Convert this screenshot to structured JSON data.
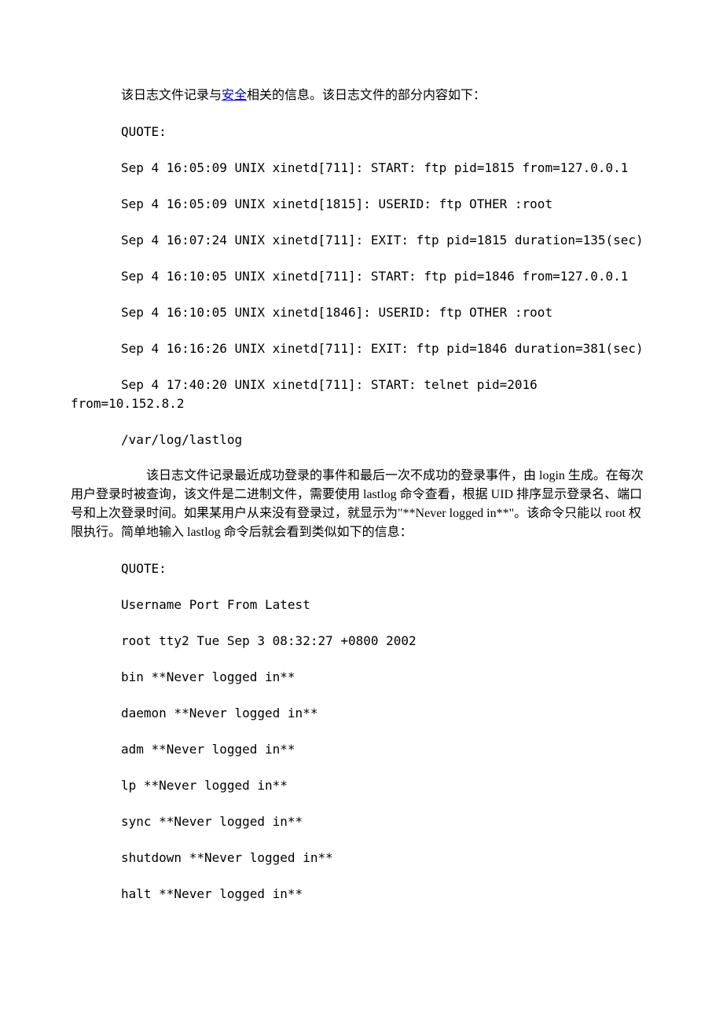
{
  "p1_a": "该日志文件记录与",
  "p1_link": "安全",
  "p1_b": "相关的信息。该日志文件的部分内容如下：",
  "quote1": "QUOTE:",
  "log1": "Sep 4 16:05:09 UNIX xinetd[711]: START: ftp pid=1815 from=127.0.0.1",
  "log2": "Sep 4 16:05:09 UNIX xinetd[1815]: USERID: ftp OTHER :root",
  "log3": "Sep 4 16:07:24 UNIX xinetd[711]: EXIT: ftp pid=1815 duration=135(sec)",
  "log4": "Sep 4 16:10:05 UNIX xinetd[711]: START: ftp pid=1846 from=127.0.0.1",
  "log5": "Sep 4 16:10:05 UNIX xinetd[1846]: USERID: ftp OTHER :root",
  "log6": "Sep 4 16:16:26 UNIX xinetd[711]: EXIT: ftp pid=1846 duration=381(sec)",
  "log7a": "Sep 4 17:40:20 UNIX xinetd[711]: START: telnet pid=2016",
  "log7b": "from=10.152.8.2",
  "path": "/var/log/lastlog",
  "desc": "该日志文件记录最近成功登录的事件和最后一次不成功的登录事件，由 login 生成。在每次用户登录时被查询，该文件是二进制文件，需要使用 lastlog 命令查看，根据 UID 排序显示登录名、端口号和上次登录时间。如果某用户从来没有登录过，就显示为\"**Never logged in**\"。该命令只能以 root 权限执行。简单地输入 lastlog 命令后就会看到类似如下的信息：",
  "quote2": "QUOTE:",
  "ll_header": "Username Port From Latest",
  "ll1": "root tty2 Tue Sep 3 08:32:27 +0800 2002",
  "ll2": "bin **Never logged in**",
  "ll3": "daemon **Never logged in**",
  "ll4": "adm **Never logged in**",
  "ll5": "lp **Never logged in**",
  "ll6": "sync **Never logged in**",
  "ll7": "shutdown **Never logged in**",
  "ll8": "halt **Never logged in**"
}
